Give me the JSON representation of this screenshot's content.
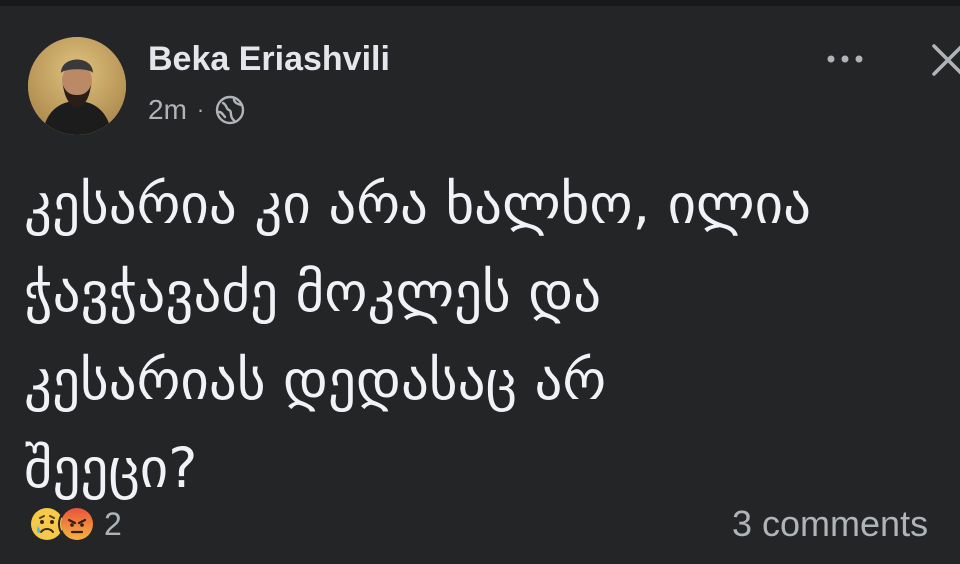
{
  "post": {
    "author": "Beka Eriashvili",
    "time": "2m",
    "separator": "·",
    "audience_icon": "globe-icon",
    "more_icon": "more-options-icon",
    "close_icon": "close-icon",
    "text_lines": [
      "კესარია კი არა ხალხო, ილია",
      "ჭავჭავაძე მოკლეს და",
      "კესარიას დედასაც არ",
      "შეეცი?"
    ],
    "reactions": {
      "icons": [
        "sad-reaction-icon",
        "angry-reaction-icon"
      ],
      "count": "2"
    },
    "comments": "3 comments"
  },
  "colors": {
    "background": "#242526",
    "primary_text": "#e4e6eb",
    "secondary_text": "#b0b3b8"
  }
}
